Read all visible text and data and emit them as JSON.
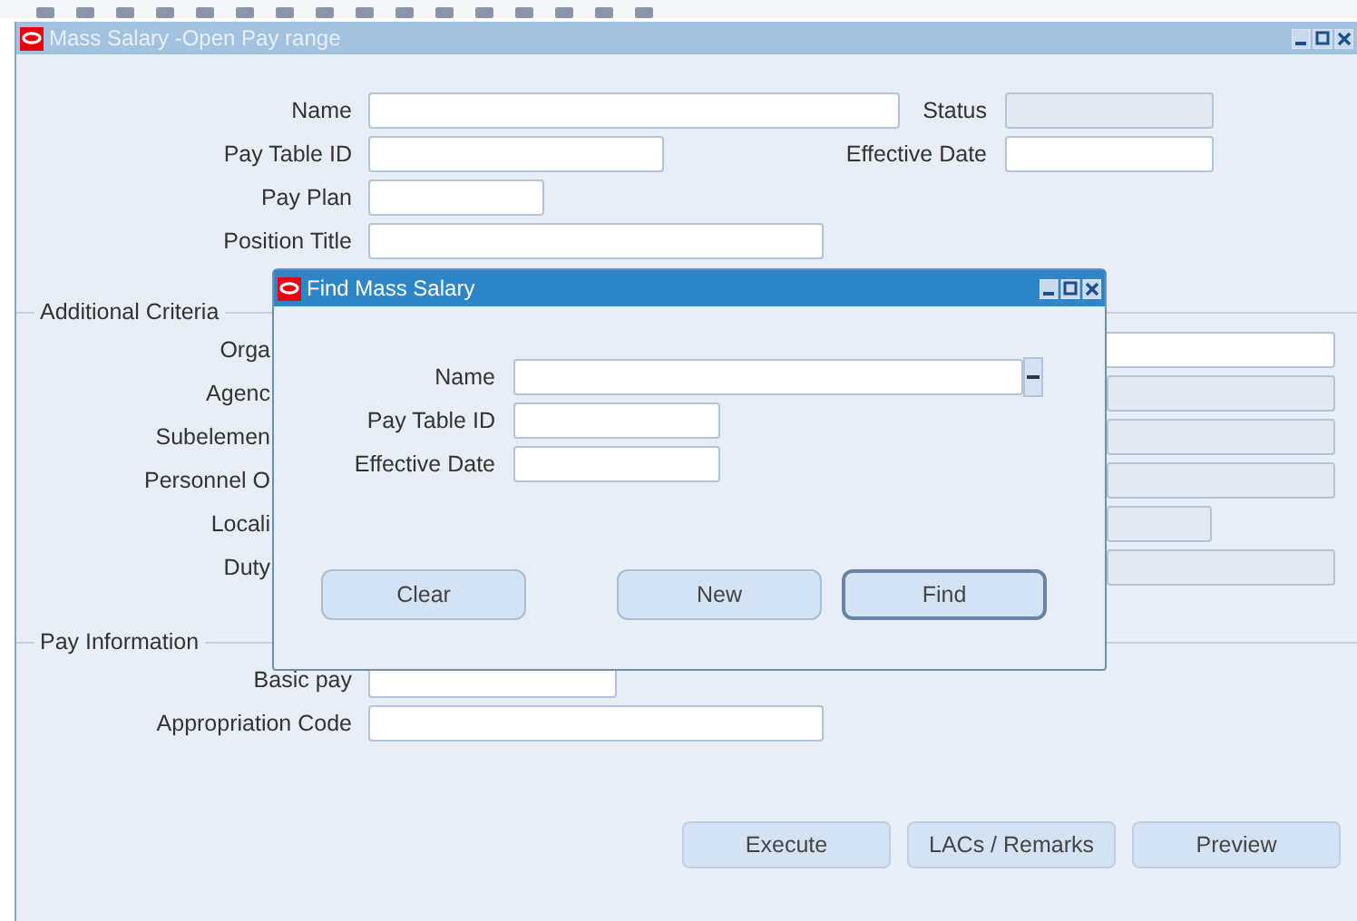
{
  "main_window": {
    "title": "Mass Salary -Open Pay range",
    "header_rows": [
      {
        "fields": [
          {
            "label": "Name",
            "disabled": false
          },
          {
            "label": "Status",
            "disabled": true
          }
        ]
      },
      {
        "fields": [
          {
            "label": "Pay Table ID",
            "disabled": false
          },
          {
            "label": "Effective Date",
            "disabled": false
          }
        ]
      },
      {
        "fields": [
          {
            "label": "Pay Plan",
            "disabled": false
          }
        ]
      },
      {
        "fields": [
          {
            "label": "Position Title",
            "disabled": false
          }
        ]
      }
    ],
    "additional_criteria": {
      "title": "Additional Criteria",
      "fields": [
        {
          "label": "Orga",
          "disabled": false
        },
        {
          "label": "Agenc",
          "disabled": true
        },
        {
          "label": "Subelemen",
          "disabled": true
        },
        {
          "label": "Personnel O",
          "disabled": true
        },
        {
          "label": "Locali",
          "disabled": true
        },
        {
          "label": "Duty",
          "disabled": true
        }
      ]
    },
    "pay_information": {
      "title": "Pay Information",
      "fields": [
        {
          "label": "Basic pay",
          "disabled": false
        },
        {
          "label": "Appropriation Code",
          "disabled": false
        }
      ]
    },
    "buttons": [
      {
        "label": "Execute"
      },
      {
        "label": "LACs / Remarks"
      },
      {
        "label": "Preview"
      }
    ]
  },
  "find_dialog": {
    "title": "Find Mass Salary",
    "fields": [
      {
        "label": "Name",
        "lov": true
      },
      {
        "label": "Pay Table ID",
        "lov": false
      },
      {
        "label": "Effective Date",
        "lov": false
      }
    ],
    "buttons": [
      {
        "label": "Clear",
        "default": false
      },
      {
        "label": "New",
        "default": false
      },
      {
        "label": "Find",
        "default": true
      }
    ]
  }
}
